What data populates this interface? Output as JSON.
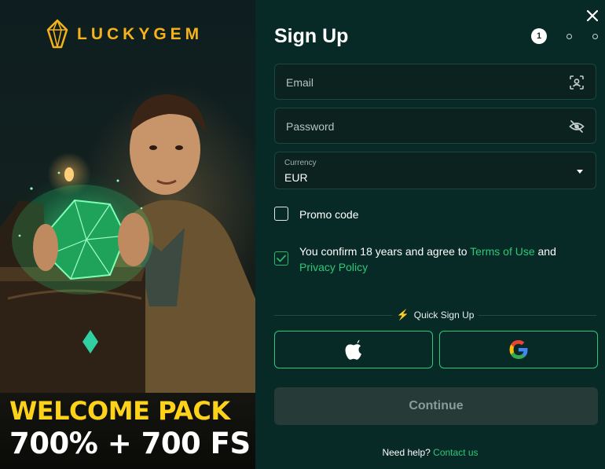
{
  "promo": {
    "brand": "LUCKYGEM",
    "headline": "WELCOME PACK",
    "offer": "700% + 700 FS"
  },
  "form": {
    "title": "Sign Up",
    "steps": {
      "current": "1",
      "total": 3
    },
    "email": {
      "placeholder": "Email",
      "value": ""
    },
    "password": {
      "placeholder": "Password",
      "value": ""
    },
    "currency": {
      "label": "Currency",
      "value": "EUR"
    },
    "promo_code": {
      "label": "Promo code",
      "checked": false
    },
    "terms": {
      "checked": true,
      "text_before": "You confirm 18 years and agree to ",
      "terms_link": "Terms of Use",
      "and": " and",
      "privacy_link": "Privacy Policy"
    },
    "quick_signup": "Quick Sign Up",
    "social": [
      "apple-icon",
      "google-icon"
    ],
    "continue_label": "Continue",
    "help_text": "Need help?",
    "contact_link": "Contact us"
  },
  "colors": {
    "panel_bg": "#072a26",
    "accent_green": "#2cc978",
    "brand_gold": "#f5b21b",
    "headline_yellow": "#ffd21a"
  }
}
